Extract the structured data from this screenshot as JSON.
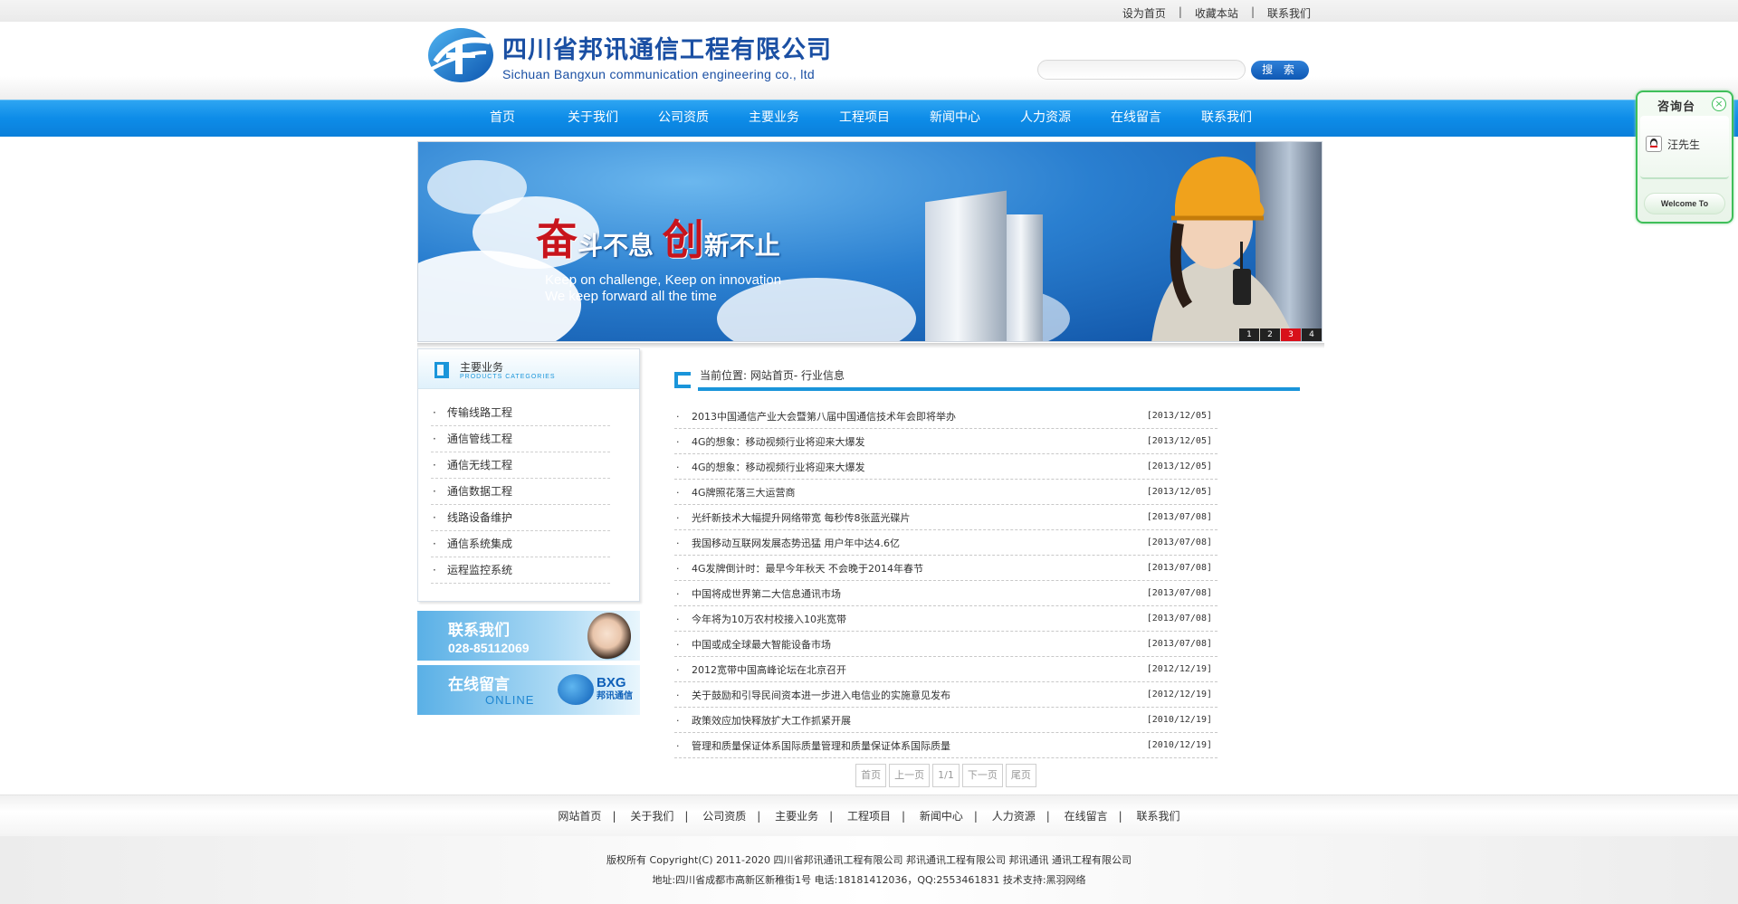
{
  "top_links": [
    "设为首页",
    "收藏本站",
    "联系我们"
  ],
  "logo": {
    "cn": "四川省邦讯通信工程有限公司",
    "en": "Sichuan Bangxun communication engineering co., ltd"
  },
  "search": {
    "placeholder": "",
    "button": "搜 索"
  },
  "nav": [
    "首页",
    "关于我们",
    "公司资质",
    "主要业务",
    "工程项目",
    "新闻中心",
    "人力资源",
    "在线留言",
    "联系我们"
  ],
  "banner": {
    "slogan_c1": "奋",
    "slogan_t1": "斗不息",
    "slogan_c2": "创",
    "slogan_t2": "新不止",
    "en_line1": "Keep on challenge, Keep on innovation",
    "en_line2": "We keep forward all the time",
    "pager": [
      "1",
      "2",
      "3",
      "4"
    ],
    "active_page": 3
  },
  "sidebar": {
    "title": "主要业务",
    "subtitle": "PRODUCTS CATEGORIES",
    "items": [
      "传输线路工程",
      "通信管线工程",
      "通信无线工程",
      "通信数据工程",
      "线路设备维护",
      "通信系统集成",
      "运程监控系统"
    ],
    "ad_contact_title": "联系我们",
    "ad_contact_phone": "028-85112069",
    "ad_online_title": "在线留言",
    "ad_online_en": "ONLINE",
    "ad_online_brand": "BXG",
    "ad_online_brand_cn": "邦讯通信"
  },
  "main": {
    "breadcrumb": "当前位置: 网站首页- 行业信息",
    "news": [
      {
        "title": "2013中国通信产业大会暨第八届中国通信技术年会即将举办",
        "date": "[2013/12/05]"
      },
      {
        "title": "4G的想象：移动视频行业将迎来大爆发",
        "date": "[2013/12/05]"
      },
      {
        "title": "4G的想象：移动视频行业将迎来大爆发",
        "date": "[2013/12/05]"
      },
      {
        "title": "4G牌照花落三大运营商",
        "date": "[2013/12/05]"
      },
      {
        "title": "光纤新技术大幅提升网络带宽 每秒传8张蓝光碟片",
        "date": "[2013/07/08]"
      },
      {
        "title": "我国移动互联网发展态势迅猛 用户年中达4.6亿",
        "date": "[2013/07/08]"
      },
      {
        "title": "4G发牌倒计时：最早今年秋天 不会晚于2014年春节",
        "date": "[2013/07/08]"
      },
      {
        "title": "中国将成世界第二大信息通讯市场",
        "date": "[2013/07/08]"
      },
      {
        "title": "今年将为10万农村校接入10兆宽带",
        "date": "[2013/07/08]"
      },
      {
        "title": "中国或成全球最大智能设备市场",
        "date": "[2013/07/08]"
      },
      {
        "title": "2012宽带中国高峰论坛在北京召开",
        "date": "[2012/12/19]"
      },
      {
        "title": "关于鼓励和引导民间资本进一步进入电信业的实施意见发布",
        "date": "[2012/12/19]"
      },
      {
        "title": "政策效应加快释放扩大工作抓紧开展",
        "date": "[2010/12/19]"
      },
      {
        "title": "管理和质量保证体系国际质量管理和质量保证体系国际质量",
        "date": "[2010/12/19]"
      }
    ],
    "pager": [
      "首页",
      "上一页",
      "1/1",
      "下一页",
      "尾页"
    ]
  },
  "footer": {
    "links": [
      "网站首页",
      "关于我们",
      "公司资质",
      "主要业务",
      "工程项目",
      "新闻中心",
      "人力资源",
      "在线留言",
      "联系我们"
    ],
    "copyright": "版权所有 Copyright(C) 2011-2020 四川省邦讯通讯工程有限公司 邦讯通讯工程有限公司 邦讯通讯 通讯工程有限公司",
    "address": "地址:四川省成都市高新区新稚街1号 电话:18181412036，QQ:2553461831 技术支持:黑羽网络"
  },
  "consult": {
    "title": "咨询台",
    "contact": "汪先生",
    "welcome": "Welcome To"
  }
}
